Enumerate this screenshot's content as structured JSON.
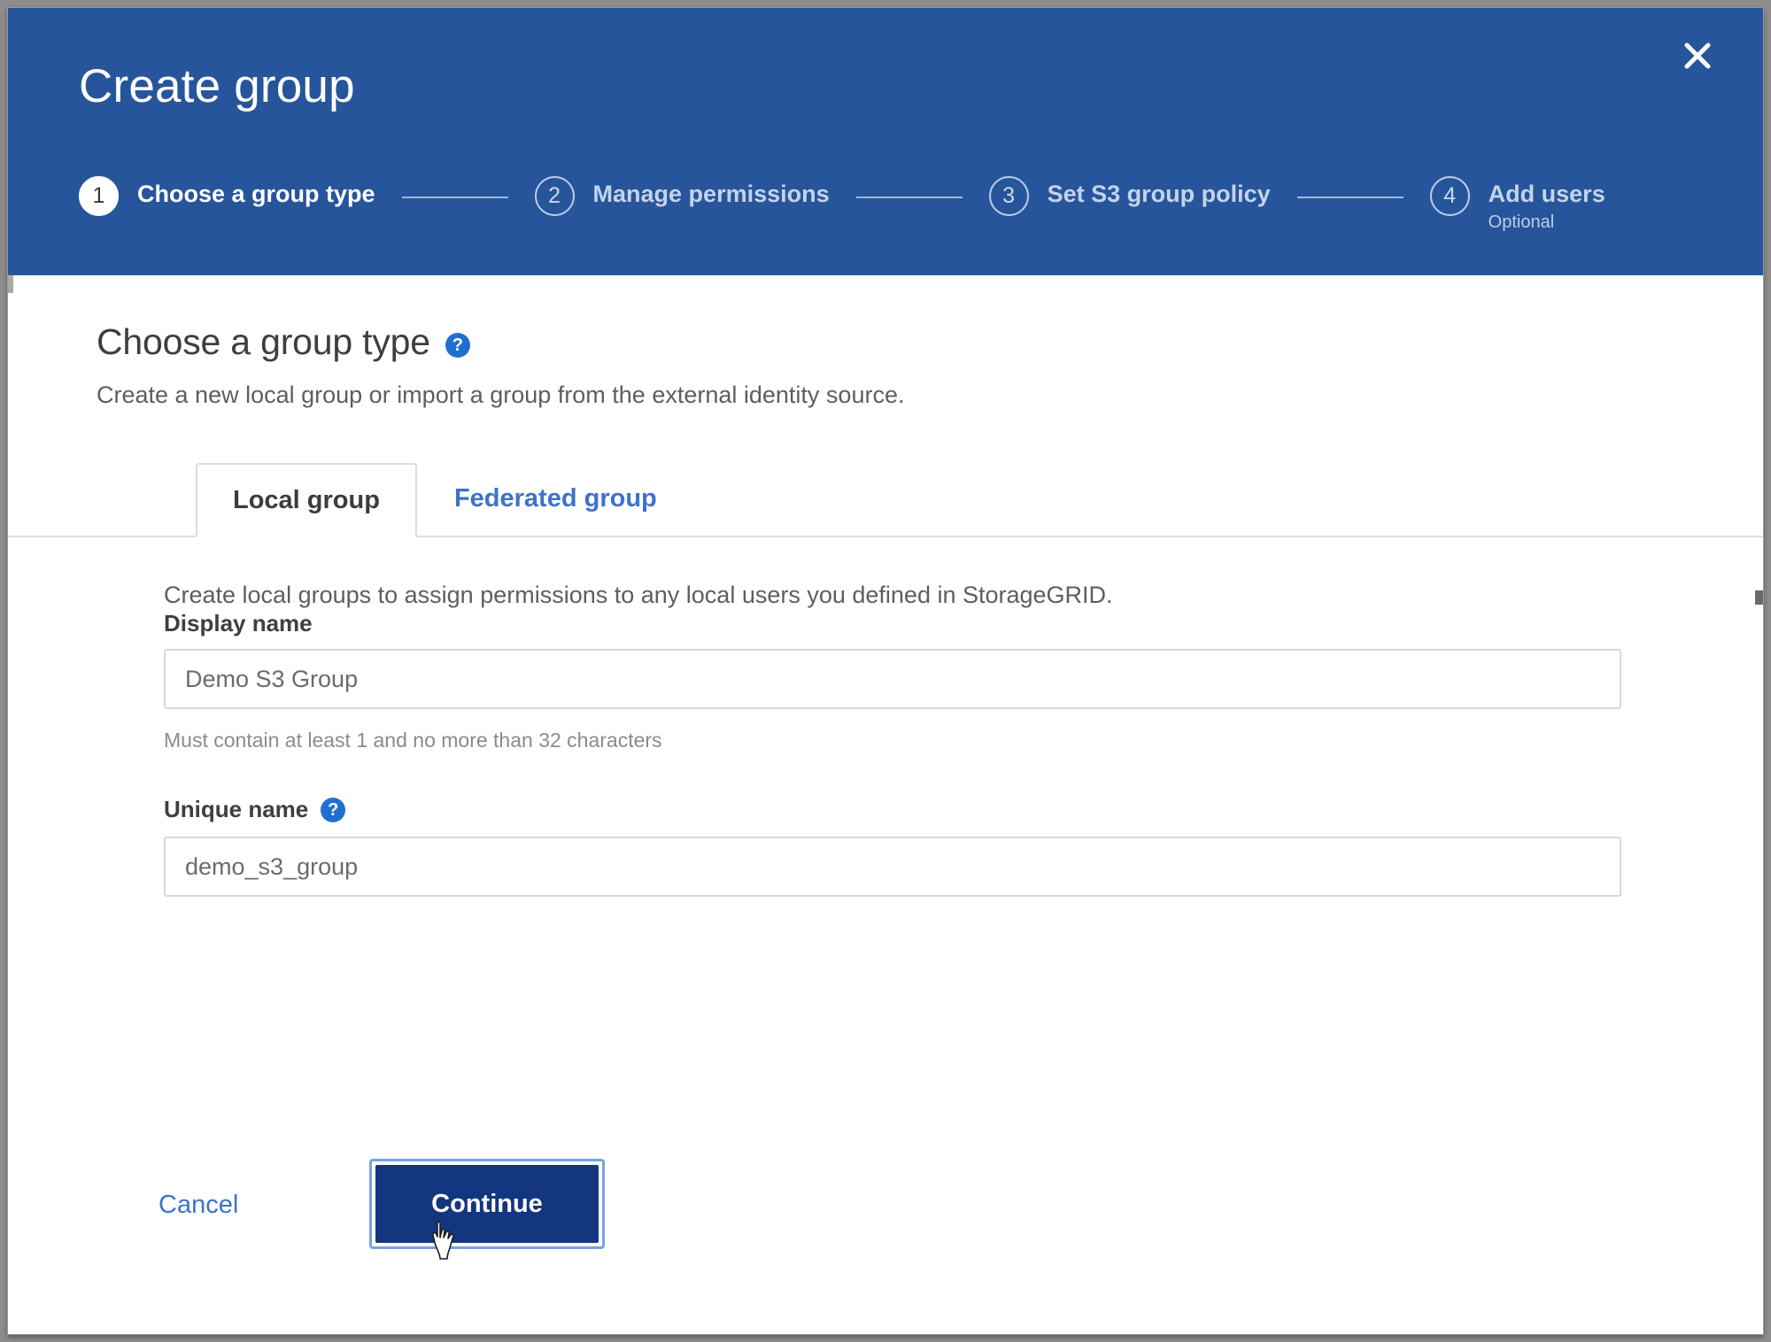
{
  "dialog": {
    "title": "Create group",
    "close_icon": "close-icon"
  },
  "stepper": {
    "steps": [
      {
        "number": "1",
        "label": "Choose a group type",
        "sub": "",
        "state": "active"
      },
      {
        "number": "2",
        "label": "Manage permissions",
        "sub": "",
        "state": "inactive"
      },
      {
        "number": "3",
        "label": "Set S3 group policy",
        "sub": "",
        "state": "inactive"
      },
      {
        "number": "4",
        "label": "Add users",
        "sub": "Optional",
        "state": "inactive"
      }
    ]
  },
  "section": {
    "title": "Choose a group type",
    "help_icon": "help-icon",
    "description": "Create a new local group or import a group from the external identity source."
  },
  "tabs": [
    {
      "label": "Local group",
      "state": "active"
    },
    {
      "label": "Federated group",
      "state": "inactive"
    }
  ],
  "form": {
    "tab_description": "Create local groups to assign permissions to any local users you defined in StorageGRID.",
    "display_name": {
      "label": "Display name",
      "value": "Demo S3 Group",
      "placeholder": "Display name",
      "hint": "Must contain at least 1 and no more than 32 characters"
    },
    "unique_name": {
      "label": "Unique name",
      "help_icon": "help-icon",
      "value": "demo_s3_group",
      "placeholder": "Unique name"
    }
  },
  "footer": {
    "cancel_label": "Cancel",
    "continue_label": "Continue"
  },
  "colors": {
    "header_blue": "#27559b",
    "primary_button": "#14357f",
    "link_blue": "#3d73c9",
    "help_icon_blue": "#1f6fd0",
    "focus_ring": "#7aa2e0"
  }
}
